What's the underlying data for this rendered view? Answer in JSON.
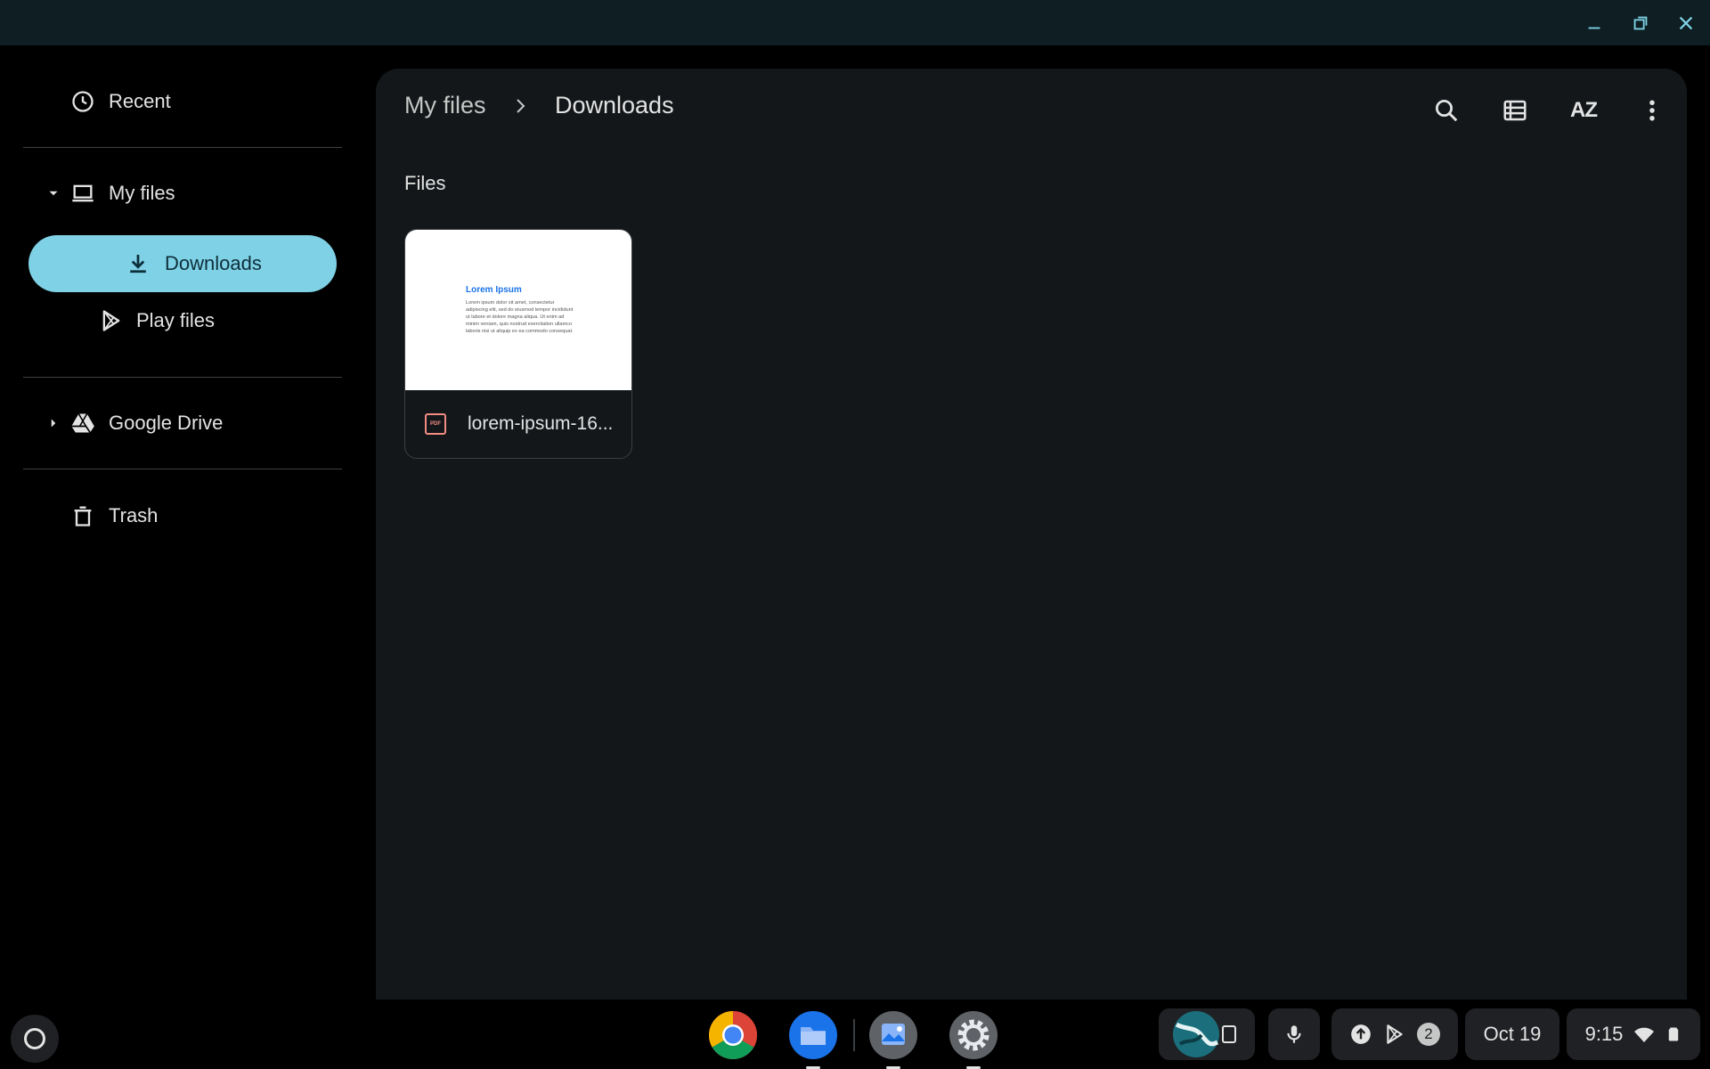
{
  "window": {
    "minimize_label": "minimize",
    "restore_label": "restore",
    "close_label": "close"
  },
  "sidebar": {
    "recent": "Recent",
    "my_files": "My files",
    "downloads": "Downloads",
    "play_files": "Play files",
    "google_drive": "Google Drive",
    "trash": "Trash"
  },
  "breadcrumb": {
    "root": "My files",
    "current": "Downloads"
  },
  "main": {
    "section_title": "Files",
    "file": {
      "name": "lorem-ipsum-16...",
      "type_badge": "PDF",
      "thumb_title": "Lorem Ipsum",
      "thumb_text": "Lorem ipsum dolor sit amet, consectetur adipiscing elit, sed do eiusmod tempor incididunt ut labore et dolore magna aliqua. Ut enim ad minim veniam, quis nostrud exercitation ullamco laboris nisi ut aliquip ex ea commodo consequat."
    }
  },
  "shelf": {
    "date": "Oct 19",
    "time": "9:15",
    "notification_count": "2"
  },
  "colors": {
    "accent": "#7fd1e6",
    "titlebar": "#0e1e22",
    "panel": "#131719"
  }
}
